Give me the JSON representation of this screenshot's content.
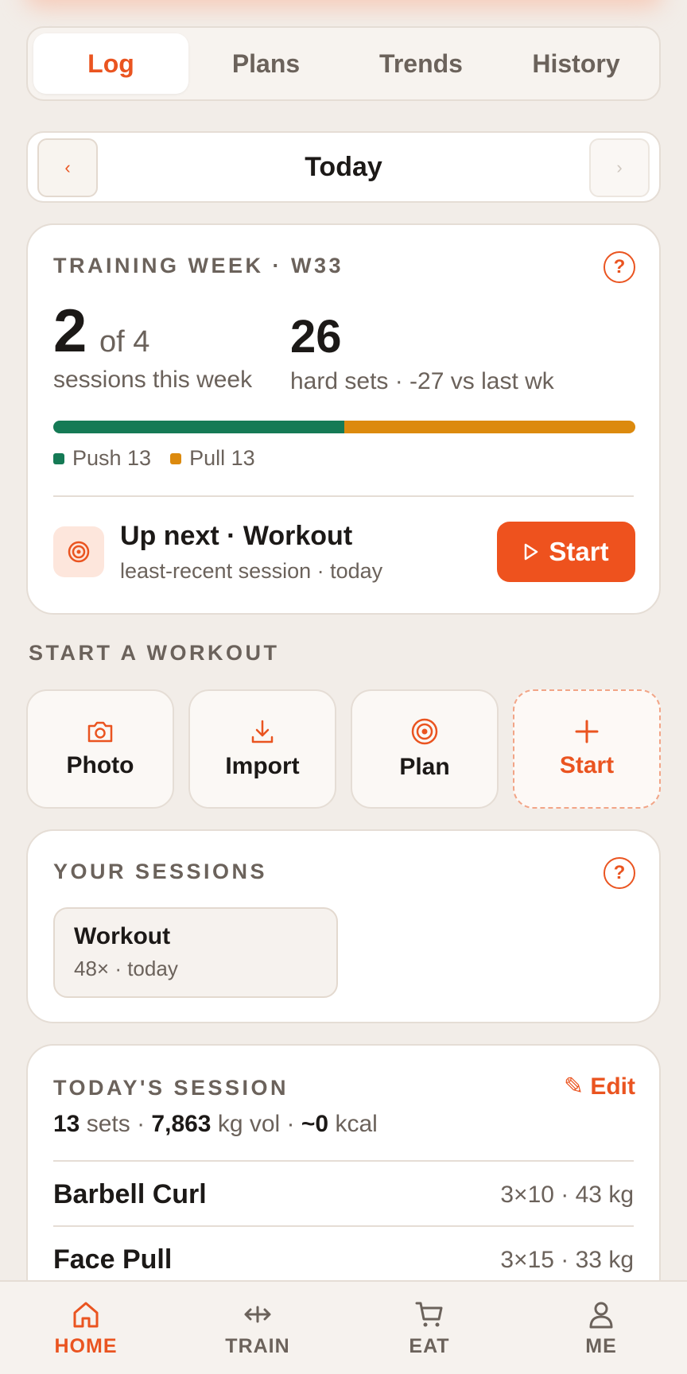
{
  "tabs": [
    {
      "label": "Log",
      "active": true
    },
    {
      "label": "Plans"
    },
    {
      "label": "Trends"
    },
    {
      "label": "History"
    }
  ],
  "date_nav": {
    "prev": "‹",
    "label": "Today",
    "next": "›"
  },
  "training_week": {
    "eyebrow": "TRAINING WEEK · W33",
    "help": "?",
    "sessions_done": "2",
    "sessions_of": "of 4",
    "sessions_label": "sessions this week",
    "hard_sets": "26",
    "hard_sets_label": "hard sets · -27 vs last wk",
    "split": {
      "push": 13,
      "pull": 13
    },
    "legend": [
      {
        "label": "Push 13",
        "color": "#157a55"
      },
      {
        "label": "Pull 13",
        "color": "#dc8a0e"
      }
    ],
    "up_next_title": "Up next · Workout",
    "up_next_sub": "least-recent session · today",
    "start_label": "Start"
  },
  "start_workout": {
    "heading": "START A WORKOUT",
    "tiles": [
      {
        "label": "Photo",
        "icon": "camera-icon"
      },
      {
        "label": "Import",
        "icon": "download-icon"
      },
      {
        "label": "Plan",
        "icon": "target-icon"
      },
      {
        "label": "Start",
        "icon": "plus-icon"
      }
    ]
  },
  "sessions": {
    "eyebrow": "YOUR SESSIONS",
    "help": "?",
    "items": [
      {
        "title": "Workout",
        "sub": "48× · today"
      }
    ]
  },
  "today_session": {
    "eyebrow": "TODAY'S SESSION",
    "edit_label": "✎ Edit",
    "sets_value": "13",
    "sets_label": "sets ·",
    "vol_value": "7,863",
    "vol_label": "kg vol ·",
    "kcal_value": "~0",
    "kcal_label": "kcal",
    "exercises": [
      {
        "name": "Barbell Curl",
        "detail": "3×10 · 43 kg"
      },
      {
        "name": "Face Pull",
        "detail": "3×15 · 33 kg"
      }
    ]
  },
  "bottom_nav": [
    {
      "label": "HOME",
      "icon": "home-icon",
      "active": true
    },
    {
      "label": "TRAIN",
      "icon": "arrows-icon"
    },
    {
      "label": "EAT",
      "icon": "cart-icon"
    },
    {
      "label": "ME",
      "icon": "person-icon"
    }
  ],
  "colors": {
    "accent": "#ea5420",
    "push": "#157a55",
    "pull": "#dc8a0e",
    "background": "#f2ede8"
  }
}
